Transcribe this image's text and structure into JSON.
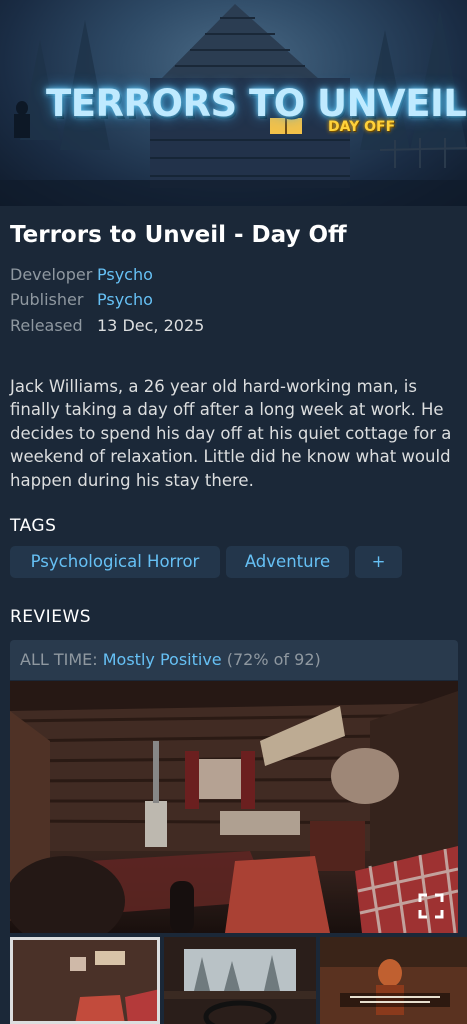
{
  "header": {
    "art_title": "TERRORS TO UNVEIL",
    "art_subtitle": "DAY OFF"
  },
  "game": {
    "title": "Terrors to Unveil - Day Off",
    "developer_label": "Developer",
    "developer": "Psycho",
    "publisher_label": "Publisher",
    "publisher": "Psycho",
    "released_label": "Released",
    "released": "13 Dec, 2025",
    "description": "Jack Williams, a 26 year old hard-working man, is finally taking a day off after a long week at work. He decides to spend his day off at his quiet cottage for a weekend of relaxation. Little did he know what would happen during his stay there."
  },
  "tags": {
    "heading": "TAGS",
    "items": [
      "Psychological Horror",
      "Adventure",
      "+"
    ]
  },
  "reviews": {
    "heading": "REVIEWS",
    "period": "ALL TIME:",
    "summary": "Mostly Positive",
    "detail": "(72% of 92)"
  },
  "media": {
    "fullscreen_icon": "fullscreen-icon",
    "selected_thumbnail": 1,
    "thumbnail_count": 3
  },
  "colors": {
    "background": "#1b2838",
    "link": "#66c0f4",
    "tag_bg": "#23364b",
    "review_bg": "#293a4d",
    "muted": "#8f98a0"
  }
}
